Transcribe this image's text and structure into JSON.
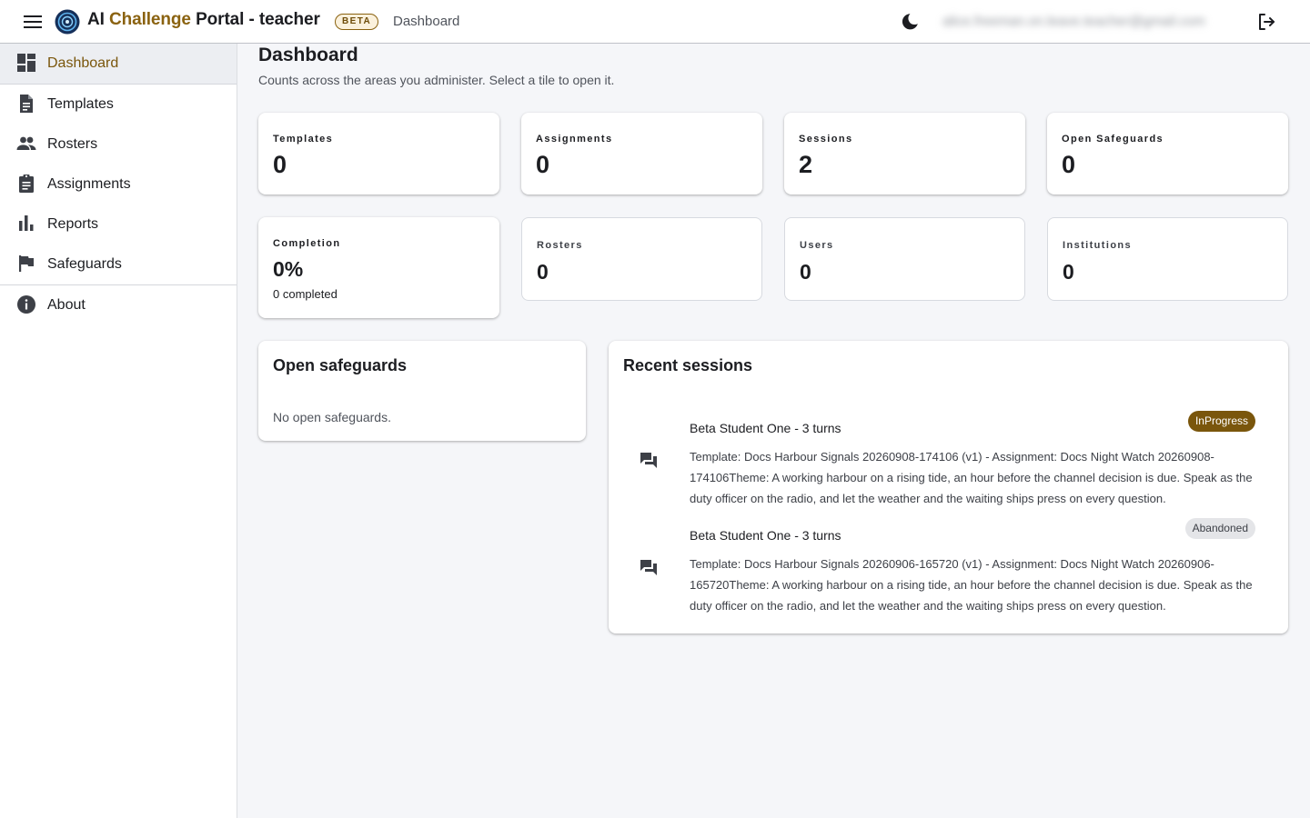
{
  "topbar": {
    "menu_icon": "menu-icon",
    "logo_icon": "portal-logo-icon",
    "brand_prefix": "AI ",
    "brand_accent": "Challenge",
    "brand_suffix": " Portal - teacher",
    "beta_label": "BETA",
    "breadcrumb": "Dashboard",
    "theme_icon": "moon-icon",
    "user_email": "alice.freeman.on.leave.teacher@gmail.com",
    "logout_icon": "logout-icon"
  },
  "sidebar": {
    "items": [
      {
        "label": "Dashboard",
        "icon": "dashboard-icon",
        "active": true
      },
      {
        "label": "Templates",
        "icon": "document-icon",
        "active": false
      },
      {
        "label": "Rosters",
        "icon": "people-icon",
        "active": false
      },
      {
        "label": "Assignments",
        "icon": "clipboard-icon",
        "active": false
      },
      {
        "label": "Reports",
        "icon": "bar-chart-icon",
        "active": false
      },
      {
        "label": "Safeguards",
        "icon": "flag-icon",
        "active": false
      },
      {
        "label": "About",
        "icon": "info-icon",
        "active": false
      }
    ]
  },
  "main": {
    "title": "Dashboard",
    "subtitle": "Counts across the areas you administer. Select a tile to open it.",
    "tiles": [
      {
        "label": "Templates",
        "value": "0"
      },
      {
        "label": "Assignments",
        "value": "0"
      },
      {
        "label": "Sessions",
        "value": "2"
      },
      {
        "label": "Open Safeguards",
        "value": "0"
      },
      {
        "label": "Completion",
        "value": "0%",
        "sub": "0 completed"
      },
      {
        "label": "Rosters",
        "value": "0"
      },
      {
        "label": "Users",
        "value": "0"
      },
      {
        "label": "Institutions",
        "value": "0"
      }
    ],
    "safeguards_card": {
      "title": "Open safeguards",
      "empty_text": "No open safeguards."
    },
    "sessions_card": {
      "title": "Recent sessions",
      "sessions": [
        {
          "title": "Beta Student One - 3 turns",
          "status": "InProgress",
          "icon": "chat-icon",
          "description": "Template: Docs Harbour Signals 20260908-174106 (v1) - Assignment: Docs Night Watch 20260908-174106Theme: A working harbour on a rising tide, an hour before the channel decision is due. Speak as the duty officer on the radio, and let the weather and the waiting ships press on every question."
        },
        {
          "title": "Beta Student One - 3 turns",
          "status": "Abandoned",
          "icon": "chat-icon",
          "description": "Template: Docs Harbour Signals 20260906-165720 (v1) - Assignment: Docs Night Watch 20260906-165720Theme: A working harbour on a rising tide, an hour before the channel decision is due. Speak as the duty officer on the radio, and let the weather and the waiting ships press on every question."
        }
      ]
    }
  },
  "colors": {
    "accent": "#8a6210",
    "chip_in_progress": "#7a560c",
    "chip_abandoned": "#e4e5e8",
    "page_background": "#f5f6f9"
  }
}
